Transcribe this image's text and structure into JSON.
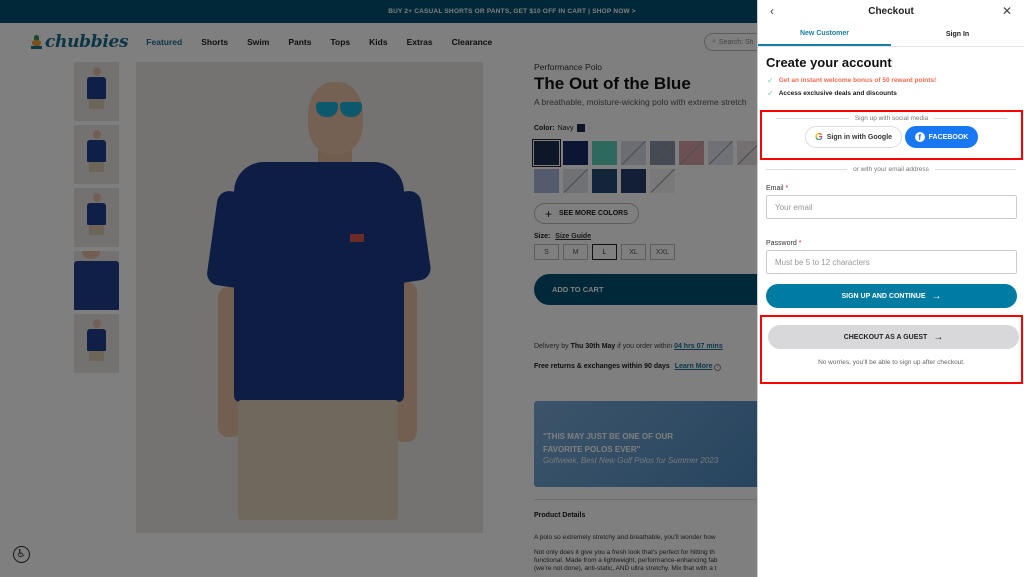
{
  "promo_banner": "BUY 2+ CASUAL SHORTS OR PANTS, GET $10 OFF IN CART | SHOP NOW >",
  "header": {
    "logo_text": "chubbies",
    "nav": [
      "Featured",
      "Shorts",
      "Swim",
      "Pants",
      "Tops",
      "Kids",
      "Extras",
      "Clearance"
    ],
    "active_nav": "Featured",
    "search_placeholder": "Search: Sh"
  },
  "product": {
    "eyebrow": "Performance Polo",
    "title": "The Out of the Blue",
    "subtitle": "A breathable, moisture-wicking polo with extreme stretch",
    "color_label": "Color:",
    "color_value": "Navy",
    "swatches": [
      {
        "name": "navy",
        "color": "#1b2f4f",
        "selected": true,
        "available": true
      },
      {
        "name": "parrot-print",
        "color": "#1b2a6a",
        "selected": false,
        "available": true
      },
      {
        "name": "seafoam",
        "color": "#5fd1b8",
        "selected": false,
        "available": true
      },
      {
        "name": "plaid",
        "color": "#d8dbe6",
        "selected": false,
        "available": false
      },
      {
        "name": "floral-gray",
        "color": "#8d95a8",
        "selected": false,
        "available": false
      },
      {
        "name": "paisley-red",
        "color": "#d7a3a8",
        "selected": false,
        "available": false
      },
      {
        "name": "stripe-light",
        "color": "#dfe3ec",
        "selected": false,
        "available": false
      },
      {
        "name": "flamingo",
        "color": "#e9e1e3",
        "selected": false,
        "available": false
      },
      {
        "name": "stripe-multi",
        "color": "#a8b7d9",
        "selected": false,
        "available": true
      },
      {
        "name": "floral-white",
        "color": "#dfe2e4",
        "selected": false,
        "available": false
      },
      {
        "name": "tropic-navy",
        "color": "#244a72",
        "selected": false,
        "available": true
      },
      {
        "name": "geo-navy",
        "color": "#273f6e",
        "selected": false,
        "available": true
      },
      {
        "name": "white",
        "color": "#f2f2f2",
        "selected": false,
        "available": false
      }
    ],
    "see_more_colors": "SEE MORE COLORS",
    "size_label": "Size:",
    "size_guide": "Size Guide",
    "sizes": [
      "S",
      "M",
      "L",
      "XL",
      "XXL"
    ],
    "selected_size": "L",
    "add_to_cart": "ADD TO CART",
    "delivery": {
      "prefix": "Delivery by",
      "date": "Thu 30th May",
      "middle": "if you order within",
      "countdown": "04 hrs 07 mins"
    },
    "returns": {
      "text": "Free returns & exchanges within 90 days",
      "link": "Learn More",
      "info_icon": "i"
    },
    "quote": {
      "line1": "\"THIS MAY JUST BE ONE OF OUR",
      "line2": "FAVORITE POLOS EVER\"",
      "source": "Golfweek,",
      "source_title": "Best New Golf Polos for Summer 2023"
    },
    "details_heading": "Product Details",
    "details_p1": "A polo so extremely stretchy and breathable, you'll wonder how",
    "details_p2_l1": "Not only does it give you a fresh look that's perfect for hitting th",
    "details_p2_l2": "functional. Made from a lightweight, performance-enhancing fab",
    "details_p2_l3": "(we're not done), anti-static, AND ultra stretchy. Mix that with a t"
  },
  "thumbnails": [
    "front",
    "back",
    "side",
    "detail",
    "full"
  ],
  "accessibility_button": "accessibility",
  "checkout": {
    "title": "Checkout",
    "back_icon": "‹",
    "close_icon": "✕",
    "tabs": [
      "New Customer",
      "Sign In"
    ],
    "active_tab": "New Customer",
    "heading": "Create your account",
    "benefits": [
      {
        "text": "Get an instant welcome bonus of 50 reward points!",
        "highlight": true
      },
      {
        "text": "Access exclusive deals and discounts",
        "highlight": false
      }
    ],
    "social_label": "Sign up with social media",
    "google_label": "Sign in with Google",
    "facebook_label": "FACEBOOK",
    "email_sep": "or with your email address",
    "email_label": "Email",
    "email_placeholder": "Your email",
    "password_label": "Password",
    "password_placeholder": "Must be 5 to 12 characters",
    "required_mark": "*",
    "signup_button": "SIGN UP AND CONTINUE",
    "guest_button": "CHECKOUT AS A GUEST",
    "guest_note": "No worries, you'll be able to sign up after checkout.",
    "arrow": "→"
  },
  "colors": {
    "brand_teal": "#005172",
    "accent_blue": "#1b7ea1",
    "signup_button": "#007ba1",
    "facebook": "#1877f2",
    "highlight_text": "#f06a4f",
    "annotation_red": "#ff0000"
  }
}
